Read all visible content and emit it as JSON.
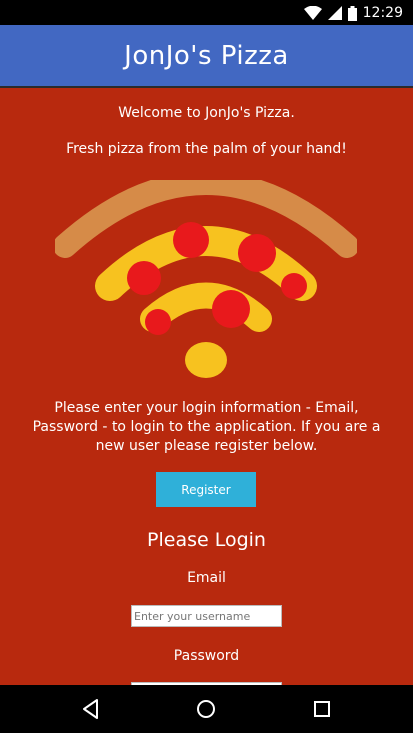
{
  "status_bar": {
    "time": "12:29",
    "icons": [
      "wifi-icon",
      "signal-icon",
      "battery-icon"
    ]
  },
  "app_bar": {
    "title": "JonJo's Pizza",
    "color": "#4268c2"
  },
  "content": {
    "background": "#b8290e",
    "welcome": "Welcome to JonJo's Pizza.",
    "tagline": "Fresh pizza from the palm of your hand!",
    "logo_icon": "pizza-wifi-logo",
    "info_text": "Please enter your login information - Email, Password - to login to the application. If you are a new user please register below.",
    "register_button": "Register",
    "register_color": "#2fb0d9",
    "login_heading": "Please Login",
    "email_label": "Email",
    "email_placeholder": "Enter your username",
    "email_value": "",
    "password_label": "Password"
  },
  "nav_bar": {
    "buttons": [
      "back-icon",
      "home-icon",
      "recents-icon"
    ]
  }
}
